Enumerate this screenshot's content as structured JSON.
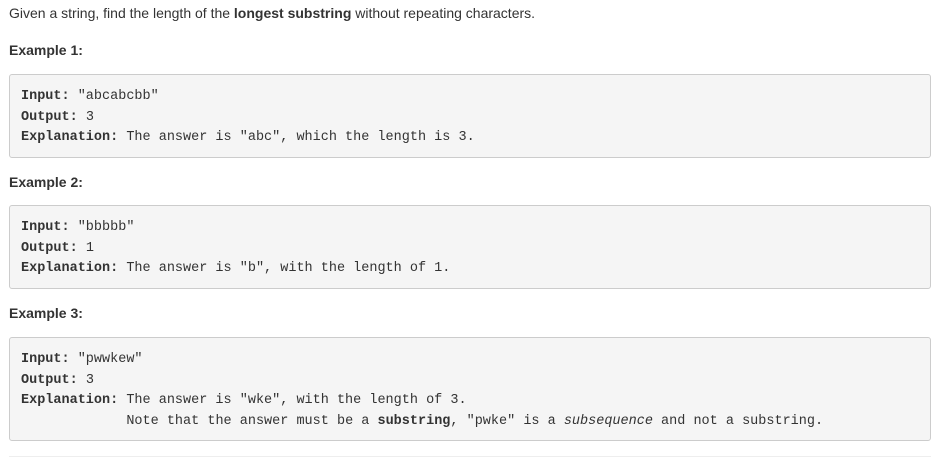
{
  "description": {
    "prefix": "Given a string, find the length of the ",
    "emphasis": "longest substring",
    "suffix": " without repeating characters."
  },
  "examples": [
    {
      "heading": "Example 1:",
      "input_label": "Input:",
      "input_value": " \"abcabcbb\"",
      "output_label": "Output:",
      "output_value": " 3",
      "explanation_label": "Explanation:",
      "explanation_value": " The answer is \"abc\", which the length is 3."
    },
    {
      "heading": "Example 2:",
      "input_label": "Input:",
      "input_value": " \"bbbbb\"",
      "output_label": "Output:",
      "output_value": " 1",
      "explanation_label": "Explanation:",
      "explanation_value": " The answer is \"b\", with the length of 1."
    },
    {
      "heading": "Example 3:",
      "input_label": "Input:",
      "input_value": " \"pwwkew\"",
      "output_label": "Output:",
      "output_value": " 3",
      "explanation_label": "Explanation:",
      "explanation_value": " The answer is \"wke\", with the length of 3.",
      "note_indent": "             ",
      "note_prefix": "Note that the answer must be a ",
      "note_bold": "substring",
      "note_middle": ", \"pwke\" is a ",
      "note_italic": "subsequence",
      "note_suffix": " and not a substring."
    }
  ]
}
